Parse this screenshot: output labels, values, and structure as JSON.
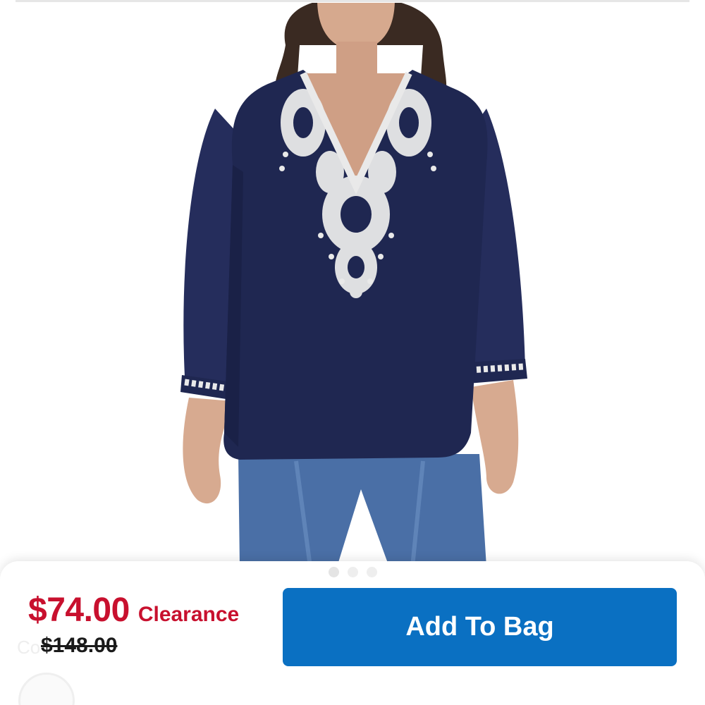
{
  "product": {
    "image_alt": "Embroidered navy tunic top",
    "gallery_total": 3,
    "gallery_active": 0
  },
  "pricing": {
    "sale_price": "$74.00",
    "price_type": "Clearance",
    "original_price": "$148.00",
    "behind_text": "Co",
    "sale_color": "#c8102e"
  },
  "actions": {
    "add_to_bag_label": "Add To Bag",
    "button_color": "#0a70c2"
  },
  "colors": {
    "garment": "#1f2751",
    "embroidery": "#e9e9e9",
    "denim": "#4a6fa6"
  }
}
